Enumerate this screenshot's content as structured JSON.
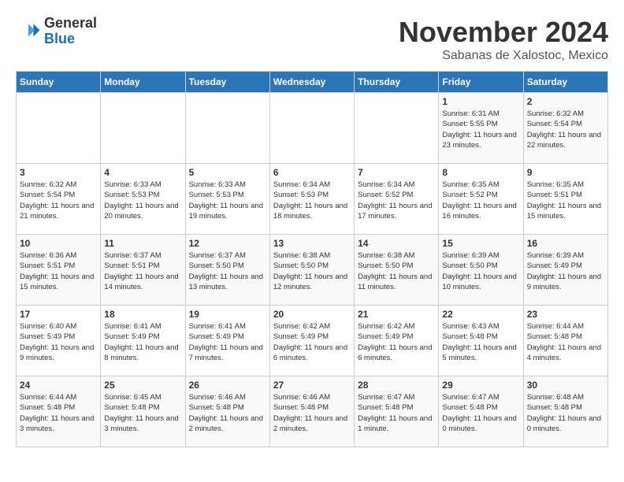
{
  "logo": {
    "general": "General",
    "blue": "Blue"
  },
  "header": {
    "month": "November 2024",
    "location": "Sabanas de Xalostoc, Mexico"
  },
  "weekdays": [
    "Sunday",
    "Monday",
    "Tuesday",
    "Wednesday",
    "Thursday",
    "Friday",
    "Saturday"
  ],
  "weeks": [
    [
      {
        "day": "",
        "info": ""
      },
      {
        "day": "",
        "info": ""
      },
      {
        "day": "",
        "info": ""
      },
      {
        "day": "",
        "info": ""
      },
      {
        "day": "",
        "info": ""
      },
      {
        "day": "1",
        "info": "Sunrise: 6:31 AM\nSunset: 5:55 PM\nDaylight: 11 hours and 23 minutes."
      },
      {
        "day": "2",
        "info": "Sunrise: 6:32 AM\nSunset: 5:54 PM\nDaylight: 11 hours and 22 minutes."
      }
    ],
    [
      {
        "day": "3",
        "info": "Sunrise: 6:32 AM\nSunset: 5:54 PM\nDaylight: 11 hours and 21 minutes."
      },
      {
        "day": "4",
        "info": "Sunrise: 6:33 AM\nSunset: 5:53 PM\nDaylight: 11 hours and 20 minutes."
      },
      {
        "day": "5",
        "info": "Sunrise: 6:33 AM\nSunset: 5:53 PM\nDaylight: 11 hours and 19 minutes."
      },
      {
        "day": "6",
        "info": "Sunrise: 6:34 AM\nSunset: 5:53 PM\nDaylight: 11 hours and 18 minutes."
      },
      {
        "day": "7",
        "info": "Sunrise: 6:34 AM\nSunset: 5:52 PM\nDaylight: 11 hours and 17 minutes."
      },
      {
        "day": "8",
        "info": "Sunrise: 6:35 AM\nSunset: 5:52 PM\nDaylight: 11 hours and 16 minutes."
      },
      {
        "day": "9",
        "info": "Sunrise: 6:35 AM\nSunset: 5:51 PM\nDaylight: 11 hours and 15 minutes."
      }
    ],
    [
      {
        "day": "10",
        "info": "Sunrise: 6:36 AM\nSunset: 5:51 PM\nDaylight: 11 hours and 15 minutes."
      },
      {
        "day": "11",
        "info": "Sunrise: 6:37 AM\nSunset: 5:51 PM\nDaylight: 11 hours and 14 minutes."
      },
      {
        "day": "12",
        "info": "Sunrise: 6:37 AM\nSunset: 5:50 PM\nDaylight: 11 hours and 13 minutes."
      },
      {
        "day": "13",
        "info": "Sunrise: 6:38 AM\nSunset: 5:50 PM\nDaylight: 11 hours and 12 minutes."
      },
      {
        "day": "14",
        "info": "Sunrise: 6:38 AM\nSunset: 5:50 PM\nDaylight: 11 hours and 11 minutes."
      },
      {
        "day": "15",
        "info": "Sunrise: 6:39 AM\nSunset: 5:50 PM\nDaylight: 11 hours and 10 minutes."
      },
      {
        "day": "16",
        "info": "Sunrise: 6:39 AM\nSunset: 5:49 PM\nDaylight: 11 hours and 9 minutes."
      }
    ],
    [
      {
        "day": "17",
        "info": "Sunrise: 6:40 AM\nSunset: 5:49 PM\nDaylight: 11 hours and 9 minutes."
      },
      {
        "day": "18",
        "info": "Sunrise: 6:41 AM\nSunset: 5:49 PM\nDaylight: 11 hours and 8 minutes."
      },
      {
        "day": "19",
        "info": "Sunrise: 6:41 AM\nSunset: 5:49 PM\nDaylight: 11 hours and 7 minutes."
      },
      {
        "day": "20",
        "info": "Sunrise: 6:42 AM\nSunset: 5:49 PM\nDaylight: 11 hours and 6 minutes."
      },
      {
        "day": "21",
        "info": "Sunrise: 6:42 AM\nSunset: 5:49 PM\nDaylight: 11 hours and 6 minutes."
      },
      {
        "day": "22",
        "info": "Sunrise: 6:43 AM\nSunset: 5:48 PM\nDaylight: 11 hours and 5 minutes."
      },
      {
        "day": "23",
        "info": "Sunrise: 6:44 AM\nSunset: 5:48 PM\nDaylight: 11 hours and 4 minutes."
      }
    ],
    [
      {
        "day": "24",
        "info": "Sunrise: 6:44 AM\nSunset: 5:48 PM\nDaylight: 11 hours and 3 minutes."
      },
      {
        "day": "25",
        "info": "Sunrise: 6:45 AM\nSunset: 5:48 PM\nDaylight: 11 hours and 3 minutes."
      },
      {
        "day": "26",
        "info": "Sunrise: 6:46 AM\nSunset: 5:48 PM\nDaylight: 11 hours and 2 minutes."
      },
      {
        "day": "27",
        "info": "Sunrise: 6:46 AM\nSunset: 5:48 PM\nDaylight: 11 hours and 2 minutes."
      },
      {
        "day": "28",
        "info": "Sunrise: 6:47 AM\nSunset: 5:48 PM\nDaylight: 11 hours and 1 minute."
      },
      {
        "day": "29",
        "info": "Sunrise: 6:47 AM\nSunset: 5:48 PM\nDaylight: 11 hours and 0 minutes."
      },
      {
        "day": "30",
        "info": "Sunrise: 6:48 AM\nSunset: 5:48 PM\nDaylight: 11 hours and 0 minutes."
      }
    ]
  ]
}
